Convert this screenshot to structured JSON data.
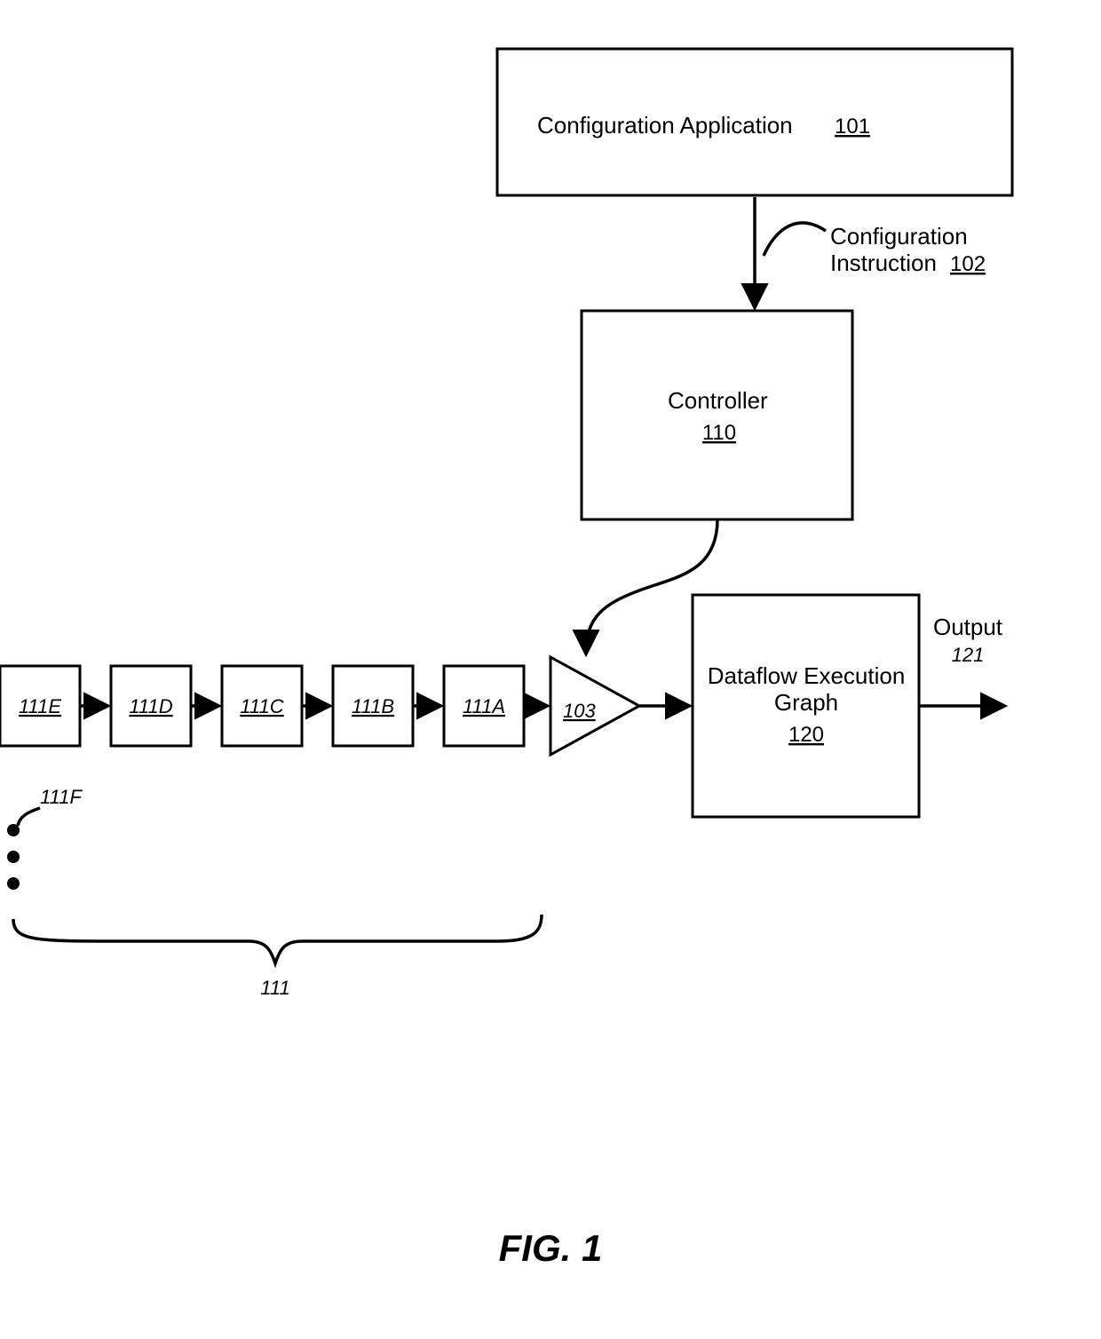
{
  "config_app": {
    "title": "Configuration Application",
    "ref": "101"
  },
  "config_instruction": {
    "line1": "Configuration",
    "line2": "Instruction",
    "ref": "102"
  },
  "controller": {
    "title": "Controller",
    "ref": "110"
  },
  "merge": {
    "ref": "103"
  },
  "graph": {
    "line1": "Dataflow Execution",
    "line2": "Graph",
    "ref": "120"
  },
  "output": {
    "label": "Output",
    "ref": "121"
  },
  "queue": {
    "ref": "111",
    "overflow_ref": "111F",
    "items": [
      "111A",
      "111B",
      "111C",
      "111D",
      "111E"
    ]
  },
  "figure": "FIG. 1"
}
